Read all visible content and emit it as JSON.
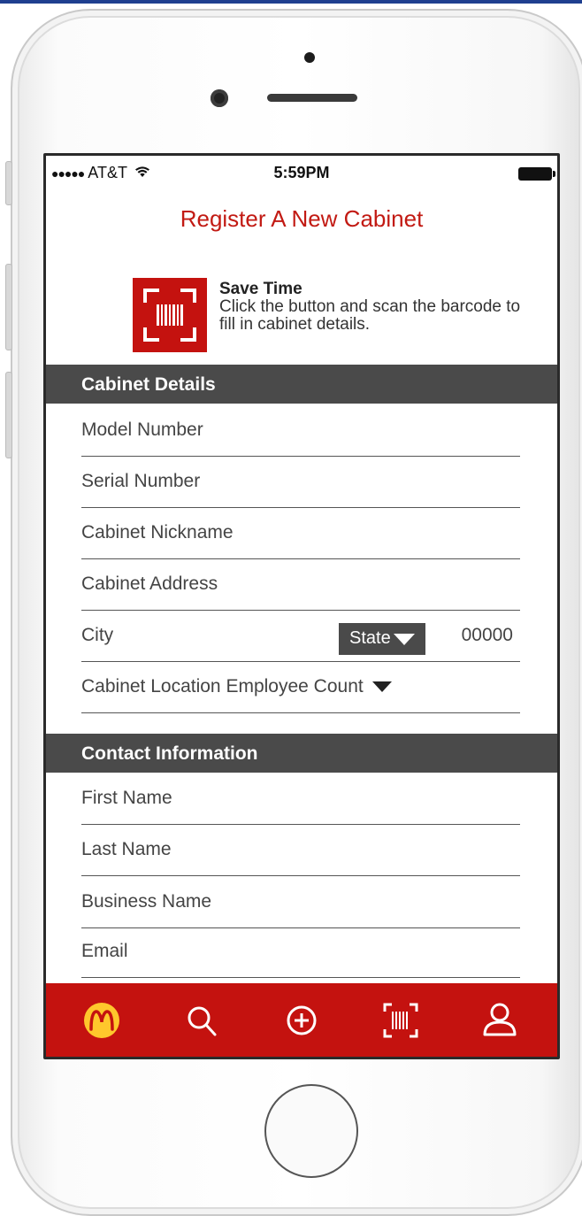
{
  "status_bar": {
    "signal": "●●●●●",
    "carrier": "AT&T",
    "time": "5:59PM"
  },
  "page": {
    "title": "Register A New Cabinet"
  },
  "scan_prompt": {
    "title": "Save Time",
    "description": "Click the button and scan the barcode to fill in cabinet details."
  },
  "cabinet_details": {
    "header": "Cabinet Details",
    "model_number": "Model Number",
    "serial_number": "Serial Number",
    "nickname": "Cabinet Nickname",
    "address": "Cabinet Address",
    "city": "City",
    "state_label": "State",
    "zip": "00000",
    "employee_count": "Cabinet Location Employee Count"
  },
  "contact_information": {
    "header": "Contact Information",
    "first_name": "First Name",
    "last_name": "Last Name",
    "business_name": "Business Name",
    "email": "Email"
  },
  "tab_bar": {
    "tabs": [
      "mcdonalds-logo-icon",
      "search-icon",
      "add-icon",
      "barcode-icon",
      "profile-icon"
    ]
  },
  "colors": {
    "brand_red": "#c4120f",
    "title_red": "#c21a13",
    "header_gray": "#4a4a4a",
    "logo_yellow": "#ffc72c"
  }
}
